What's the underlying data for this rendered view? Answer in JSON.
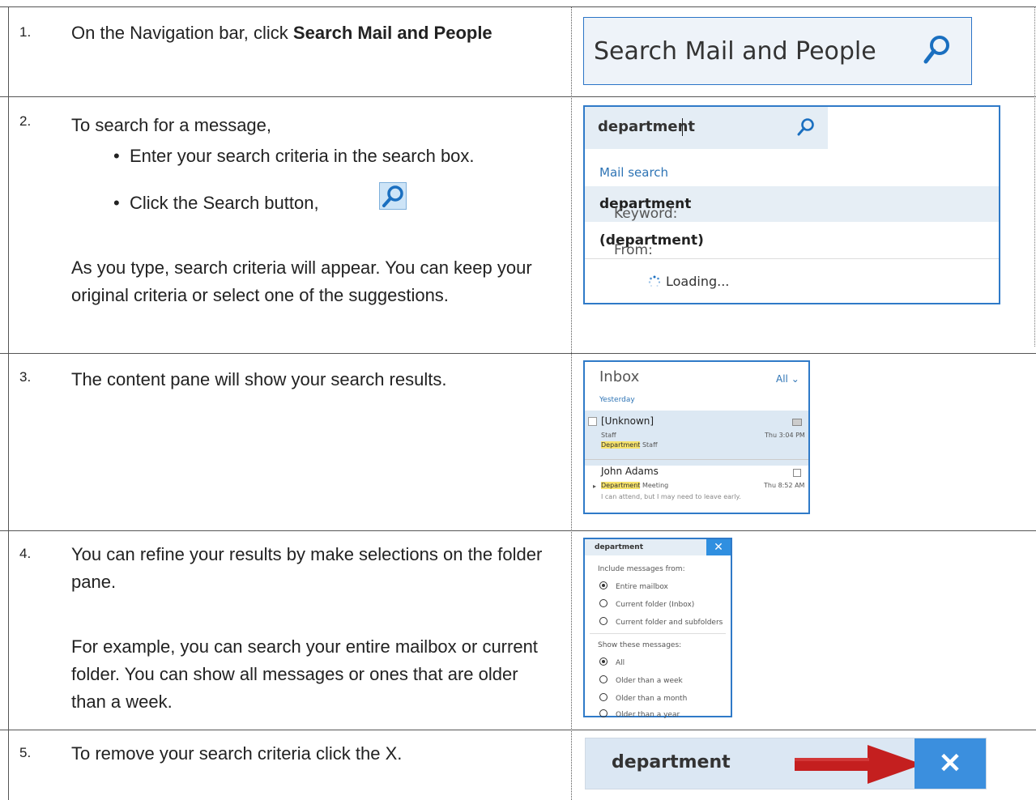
{
  "steps": [
    {
      "num": "1.",
      "text_pre": "On the Navigation bar, click ",
      "text_bold": "Search Mail and People"
    },
    {
      "num": "2.",
      "intro": "To search for a message,",
      "bullets": [
        "Enter your search criteria in the search box.",
        "Click the Search button,"
      ],
      "note": "As you type, search criteria will appear. You can keep your original criteria or select one of the suggestions."
    },
    {
      "num": "3.",
      "text": "The content pane will show your search results."
    },
    {
      "num": "4.",
      "text": "You can refine your results by make selections on the folder pane.",
      "note": "For example, you can search your entire mailbox or current folder. You can show all messages or ones that are older than a week."
    },
    {
      "num": "5.",
      "text": "To remove your search criteria click the X."
    }
  ],
  "shot1": {
    "placeholder": "Search Mail and People",
    "icon": "search-icon"
  },
  "shot2": {
    "query": "department",
    "mail_search": "Mail search",
    "keyword_label": "Keyword:",
    "keyword_value": "department",
    "from_label": "From:",
    "from_value": "(department)",
    "loading": "Loading..."
  },
  "shot3": {
    "title": "Inbox",
    "filter": "All",
    "group": "Yesterday",
    "messages": [
      {
        "sender": "[Unknown]",
        "subject": "Staff",
        "time": "Thu 3:04 PM",
        "preview_hl": "Department",
        "preview_rest": " Staff"
      },
      {
        "sender": "John Adams",
        "subject_hl": "Department",
        "subject_rest": " Meeting",
        "time": "Thu 8:52 AM",
        "preview": "I can attend, but I may need to leave early."
      }
    ]
  },
  "shot4": {
    "query": "department",
    "close": "✕",
    "include_label": "Include messages from:",
    "include_options": [
      "Entire mailbox",
      "Current folder (Inbox)",
      "Current folder and subfolders"
    ],
    "show_label": "Show these messages:",
    "show_options": [
      "All",
      "Older than a week",
      "Older than a month",
      "Older than a year"
    ]
  },
  "shot5": {
    "query": "department",
    "close": "✕"
  },
  "colors": {
    "accent": "#2f7ac8",
    "highlight": "#f7e36b",
    "arrow": "#c41f1f"
  }
}
